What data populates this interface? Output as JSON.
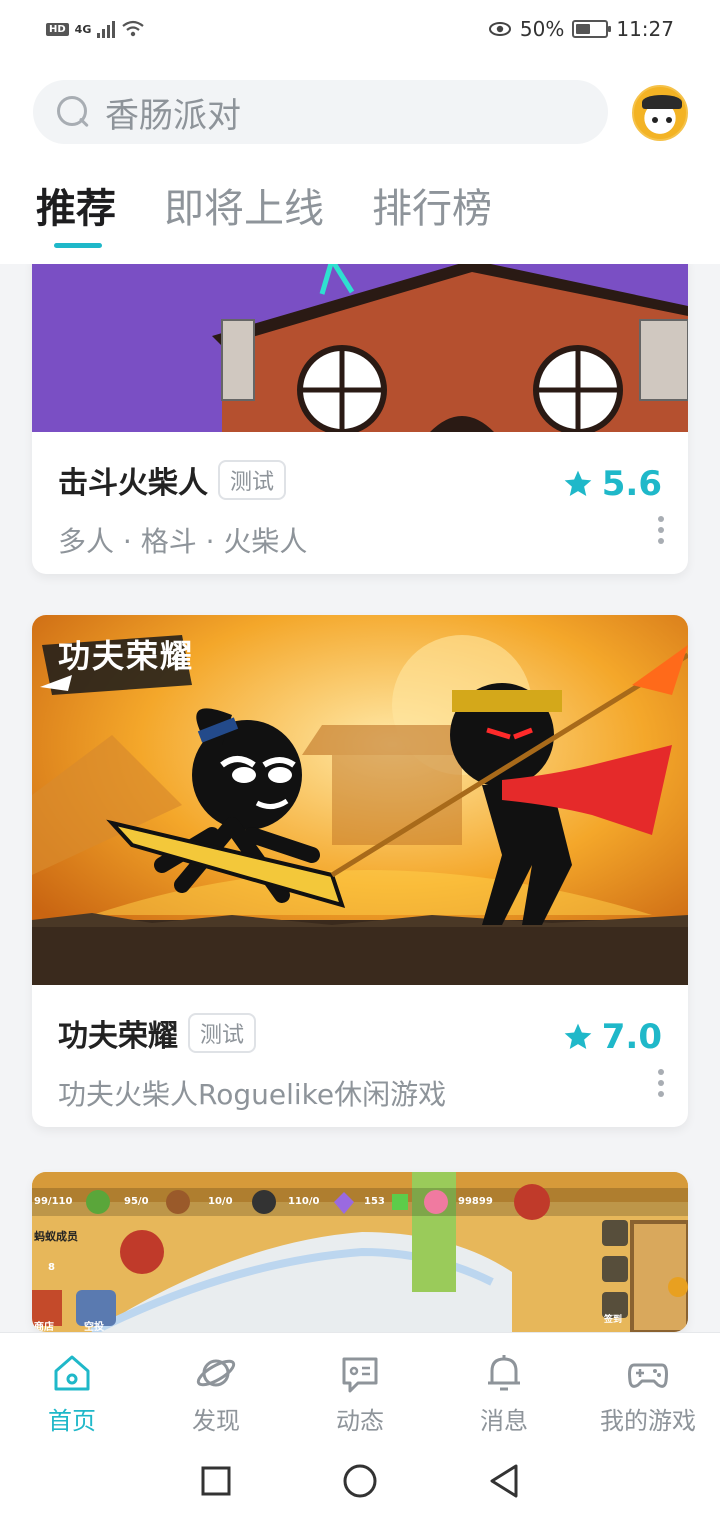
{
  "status": {
    "hd": "HD",
    "network": "4G",
    "battery": "50%",
    "battery_level": 0.5,
    "time": "11:27"
  },
  "search": {
    "placeholder": "香肠派对"
  },
  "tabs": [
    {
      "label": "推荐",
      "active": true
    },
    {
      "label": "即将上线",
      "active": false
    },
    {
      "label": "排行榜",
      "active": false
    }
  ],
  "games": [
    {
      "title": "击斗火柴人",
      "tag": "测试",
      "rating": "5.6",
      "desc": "多人 · 格斗 · 火柴人"
    },
    {
      "title": "功夫荣耀",
      "tag": "测试",
      "rating": "7.0",
      "desc": "功夫火柴人Roguelike休闲游戏",
      "logo_text": "功夫荣耀"
    },
    {
      "hud": {
        "hp": "99/110",
        "leaf": "95/0",
        "nut": "10/0",
        "ant": "110/0",
        "crystal": "153",
        "flower": "99899",
        "member": "蚂蚁成员",
        "count": "8",
        "shop": "商店",
        "airdrop": "空投",
        "signin": "签到"
      }
    }
  ],
  "nav": [
    {
      "label": "首页",
      "icon": "home-icon",
      "active": true
    },
    {
      "label": "发现",
      "icon": "planet-icon",
      "active": false
    },
    {
      "label": "动态",
      "icon": "chat-icon",
      "active": false
    },
    {
      "label": "消息",
      "icon": "bell-icon",
      "active": false
    },
    {
      "label": "我的游戏",
      "icon": "gamepad-icon",
      "active": false
    }
  ],
  "colors": {
    "accent": "#1fb8c9"
  }
}
